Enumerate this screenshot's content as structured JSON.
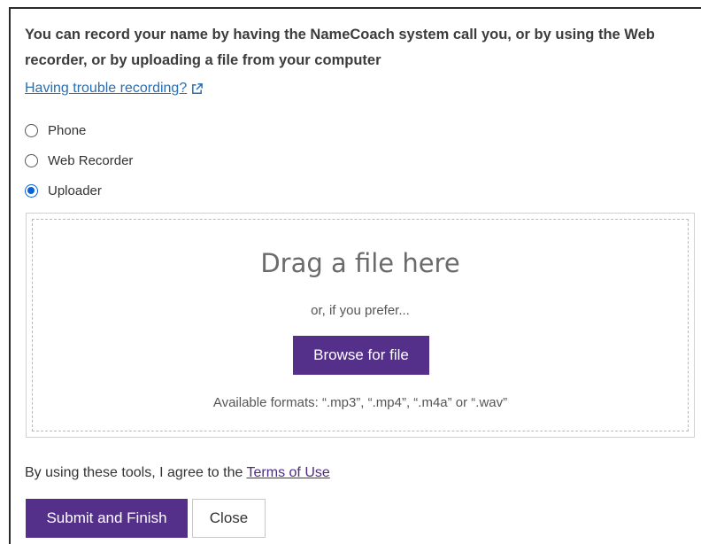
{
  "heading": "You can record your name by having the NameCoach system call you, or by using the Web recorder, or by uploading a file from your computer",
  "help_link": {
    "label": "Having trouble recording?",
    "icon": "external-link-icon"
  },
  "options": [
    {
      "label": "Phone",
      "selected": false
    },
    {
      "label": "Web Recorder",
      "selected": false
    },
    {
      "label": "Uploader",
      "selected": true
    }
  ],
  "uploader": {
    "title": "Drag a file here",
    "prefer_text": "or, if you prefer...",
    "browse_label": "Browse for file",
    "formats_text": "Available formats: “.mp3”, “.mp4”, “.m4a” or “.wav”"
  },
  "terms": {
    "prefix": "By using these tools, I agree to the ",
    "link_label": "Terms of Use"
  },
  "actions": {
    "submit_label": "Submit and Finish",
    "close_label": "Close"
  },
  "colors": {
    "accent": "#55308b",
    "link": "#2a6fb3",
    "radio_selected": "#0a63d6"
  }
}
